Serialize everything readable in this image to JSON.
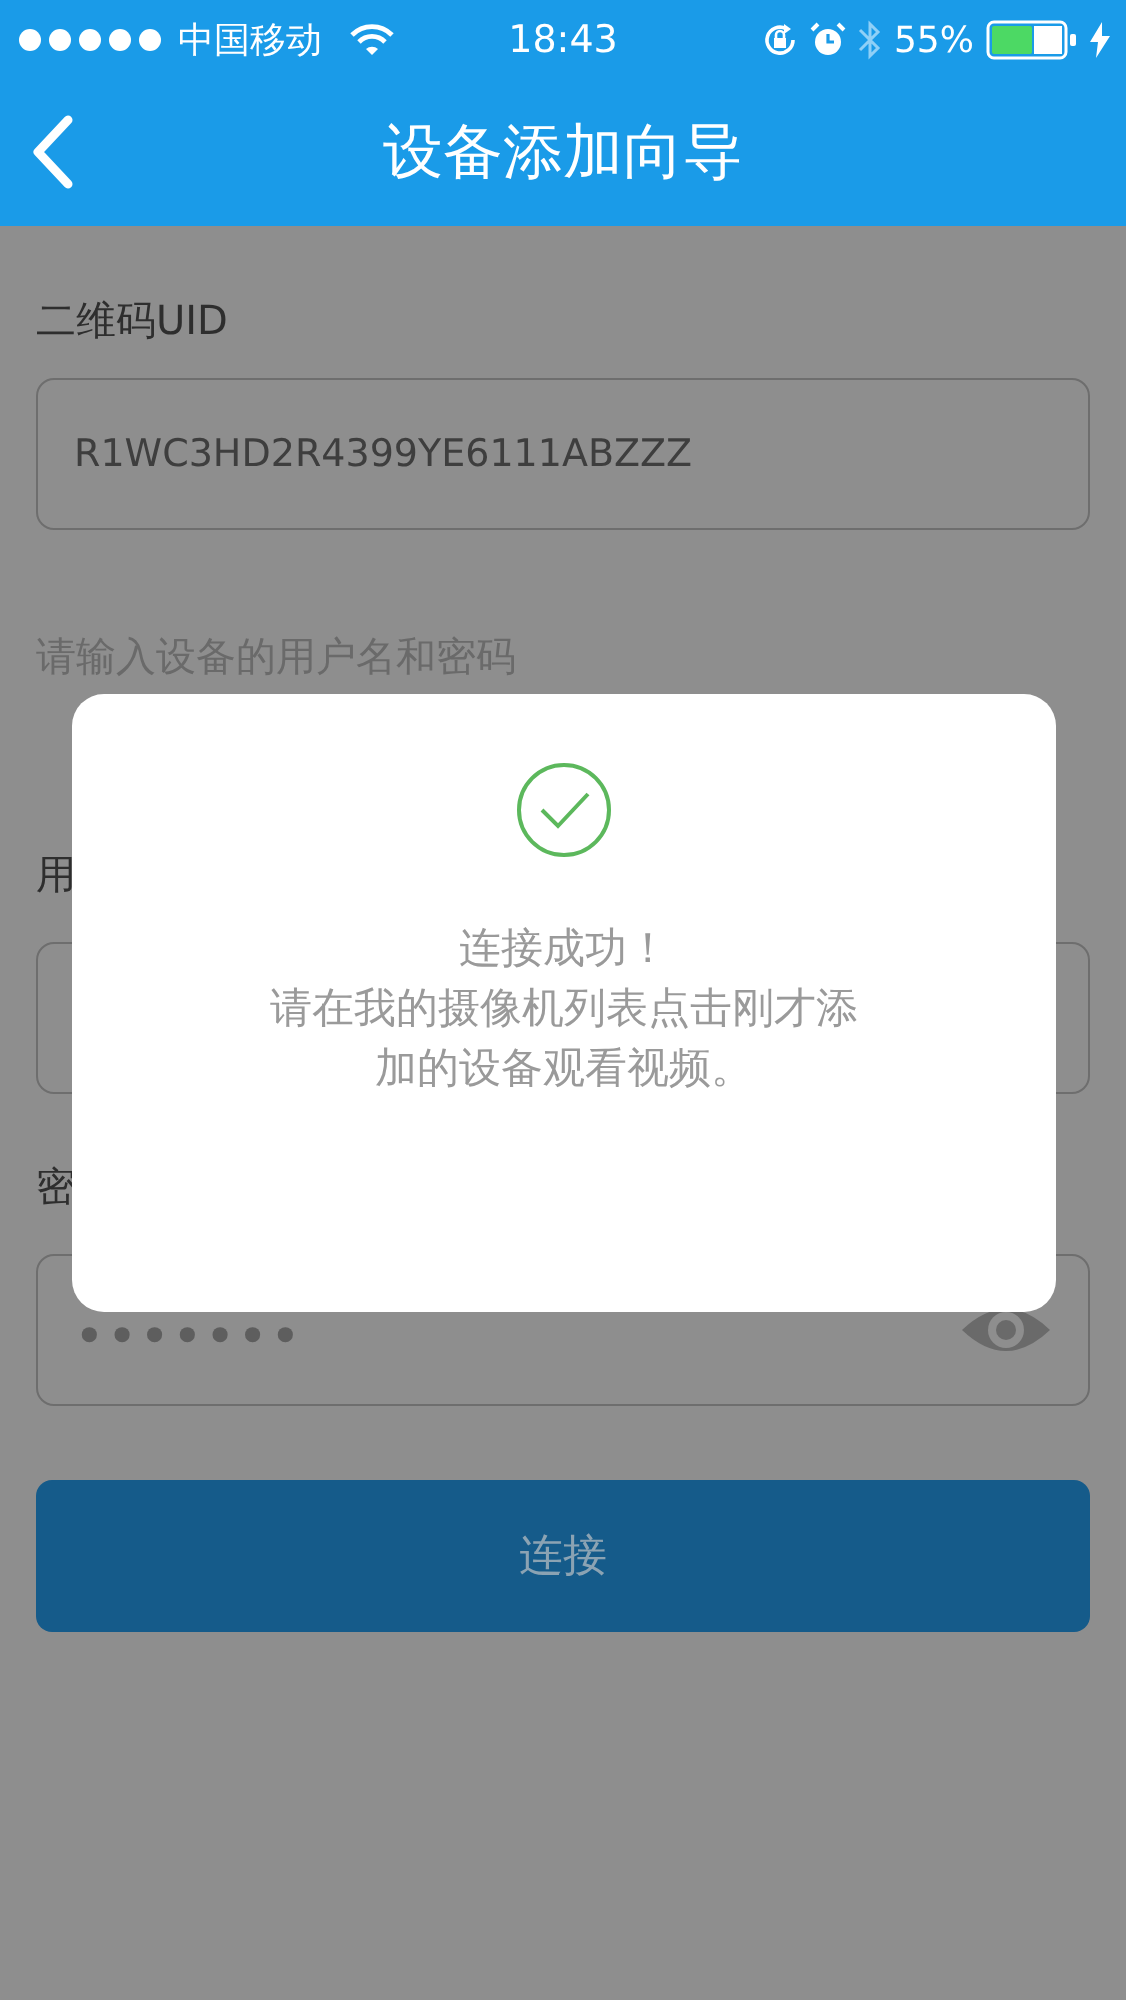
{
  "status_bar": {
    "carrier": "中国移动",
    "time": "18:43",
    "battery": "55%"
  },
  "header": {
    "title": "设备添加向导"
  },
  "form": {
    "uid_label": "二维码UID",
    "uid_value": "R1WC3HD2R4399YE6111ABZZZ",
    "hint": "请输入设备的用户名和密码",
    "username_label": "用",
    "password_label": "密",
    "password_value": "•••••••",
    "connect_button": "连接"
  },
  "dialog": {
    "message_lines": [
      "连接成功！",
      "请在我的摄像机列表点击刚才添",
      "加的设备观看视频。"
    ]
  }
}
